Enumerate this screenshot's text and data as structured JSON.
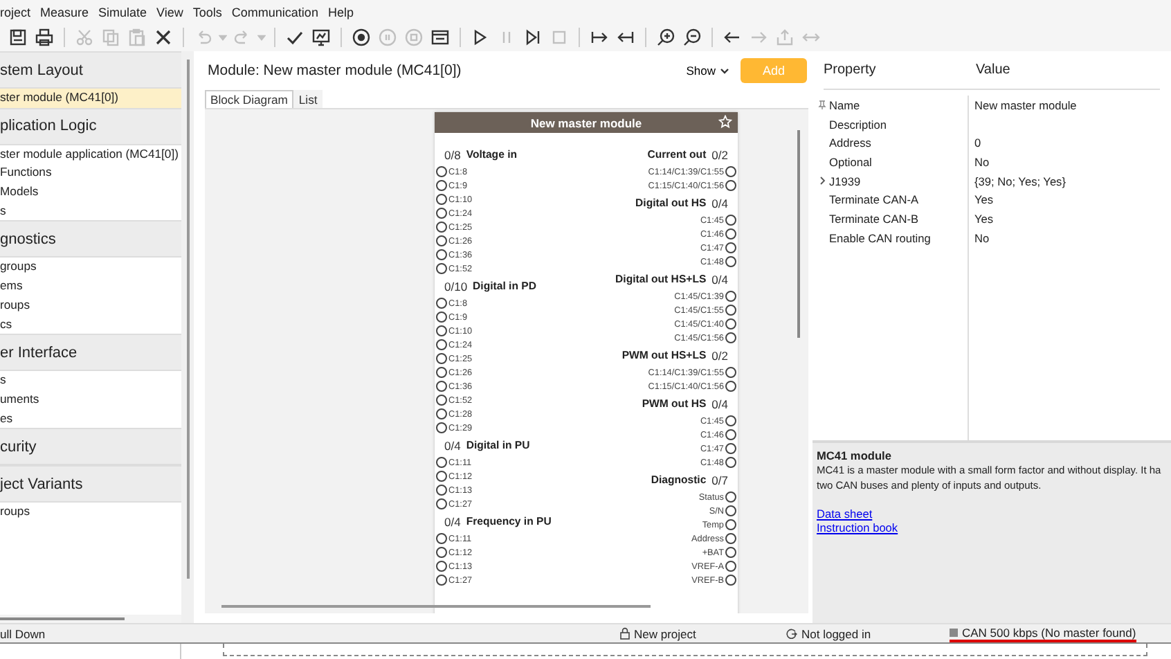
{
  "menu": [
    "roject",
    "Measure",
    "Simulate",
    "View",
    "Tools",
    "Communication",
    "Help"
  ],
  "toolbar": [
    {
      "kind": "save",
      "disabled": false
    },
    {
      "kind": "print",
      "disabled": false
    },
    {
      "kind": "separator"
    },
    {
      "kind": "cut",
      "disabled": true
    },
    {
      "kind": "copy",
      "disabled": true
    },
    {
      "kind": "paste",
      "disabled": true
    },
    {
      "kind": "delete",
      "disabled": false
    },
    {
      "kind": "separator"
    },
    {
      "kind": "undo",
      "disabled": true
    },
    {
      "kind": "dropdown",
      "disabled": true
    },
    {
      "kind": "redo",
      "disabled": true
    },
    {
      "kind": "dropdown",
      "disabled": true
    },
    {
      "kind": "separator"
    },
    {
      "kind": "check",
      "disabled": false
    },
    {
      "kind": "monitor",
      "disabled": false
    },
    {
      "kind": "separator"
    },
    {
      "kind": "record",
      "disabled": false
    },
    {
      "kind": "pause-circle",
      "disabled": true
    },
    {
      "kind": "stop-circle",
      "disabled": true
    },
    {
      "kind": "panel",
      "disabled": false
    },
    {
      "kind": "separator"
    },
    {
      "kind": "play",
      "disabled": false
    },
    {
      "kind": "pause",
      "disabled": true
    },
    {
      "kind": "step",
      "disabled": false
    },
    {
      "kind": "stop",
      "disabled": true
    },
    {
      "kind": "separator"
    },
    {
      "kind": "step-in",
      "disabled": false
    },
    {
      "kind": "step-out",
      "disabled": false
    },
    {
      "kind": "separator"
    },
    {
      "kind": "zoom-in",
      "disabled": false
    },
    {
      "kind": "zoom-out",
      "disabled": false
    },
    {
      "kind": "separator"
    },
    {
      "kind": "back",
      "disabled": false
    },
    {
      "kind": "forward",
      "disabled": true
    },
    {
      "kind": "export",
      "disabled": true
    },
    {
      "kind": "swap",
      "disabled": true
    }
  ],
  "sidebar": {
    "sections": [
      {
        "title": "stem Layout",
        "items": [
          {
            "label": "ster module (MC41[0])",
            "selected": true
          }
        ]
      },
      {
        "title": "plication Logic",
        "items": [
          {
            "label": "ster module application (MC41[0])",
            "selected": false
          },
          {
            "label": "Functions",
            "selected": false
          },
          {
            "label": "Models",
            "selected": false
          },
          {
            "label": "s",
            "selected": false
          }
        ]
      },
      {
        "title": "gnostics",
        "items": [
          {
            "label": "groups",
            "selected": false
          },
          {
            "label": "ems",
            "selected": false
          },
          {
            "label": "roups",
            "selected": false
          },
          {
            "label": "cs",
            "selected": false
          }
        ]
      },
      {
        "title": "er Interface",
        "items": [
          {
            "label": "s",
            "selected": false
          },
          {
            "label": "uments",
            "selected": false
          },
          {
            "label": "es",
            "selected": false
          }
        ]
      },
      {
        "title": "curity"
      },
      {
        "title": "ject Variants",
        "items": [
          {
            "label": "roups",
            "selected": false
          }
        ]
      }
    ]
  },
  "module_panel": {
    "title": "Module: New master module (MC41[0])",
    "show_button": "Show",
    "add_button": "Add",
    "tabs": [
      {
        "label": "Block Diagram",
        "selected": true
      },
      {
        "label": "List",
        "selected": false
      }
    ],
    "module": {
      "title": "New master module",
      "inputs": [
        {
          "count": "0/8",
          "title": "Voltage in",
          "pins": [
            "C1:8",
            "C1:9",
            "C1:10",
            "C1:24",
            "C1:25",
            "C1:26",
            "C1:36",
            "C1:52"
          ]
        },
        {
          "count": "0/10",
          "title": "Digital in PD",
          "pins": [
            "C1:8",
            "C1:9",
            "C1:10",
            "C1:24",
            "C1:25",
            "C1:26",
            "C1:36",
            "C1:52",
            "C1:28",
            "C1:29"
          ]
        },
        {
          "count": "0/4",
          "title": "Digital in PU",
          "pins": [
            "C1:11",
            "C1:12",
            "C1:13",
            "C1:27"
          ]
        },
        {
          "count": "0/4",
          "title": "Frequency in PU",
          "pins": [
            "C1:11",
            "C1:12",
            "C1:13",
            "C1:27"
          ]
        }
      ],
      "outputs": [
        {
          "count": "0/2",
          "title": "Current out",
          "pins": [
            "C1:14/C1:39/C1:55",
            "C1:15/C1:40/C1:56"
          ]
        },
        {
          "count": "0/4",
          "title": "Digital out HS",
          "pins": [
            "C1:45",
            "C1:46",
            "C1:47",
            "C1:48"
          ]
        },
        {
          "count": "0/4",
          "title": "Digital out HS+LS",
          "pins": [
            "C1:45/C1:39",
            "C1:45/C1:55",
            "C1:45/C1:40",
            "C1:45/C1:56"
          ]
        },
        {
          "count": "0/2",
          "title": "PWM out HS+LS",
          "pins": [
            "C1:14/C1:39/C1:55",
            "C1:15/C1:40/C1:56"
          ]
        },
        {
          "count": "0/4",
          "title": "PWM out HS",
          "pins": [
            "C1:45",
            "C1:46",
            "C1:47",
            "C1:48"
          ]
        },
        {
          "count": "0/7",
          "title": "Diagnostic",
          "pins": [
            "Status",
            "S/N",
            "Temp",
            "Address",
            "+BAT",
            "VREF-A",
            "VREF-B"
          ]
        }
      ]
    }
  },
  "properties": {
    "columns": [
      "Property",
      "Value"
    ],
    "rows": [
      {
        "name": "Name",
        "value": "New master module",
        "kind": "pinned"
      },
      {
        "name": "Description",
        "kind": "plain"
      },
      {
        "name": "Address",
        "value": "0",
        "kind": "plain"
      },
      {
        "name": "Optional",
        "value": "No",
        "kind": "plain"
      },
      {
        "name": "J1939",
        "value": "{39; No; Yes; Yes}",
        "kind": "expandable",
        "expanded": false
      },
      {
        "name": "Terminate CAN-A",
        "value": "Yes",
        "kind": "plain"
      },
      {
        "name": "Terminate CAN-B",
        "value": "Yes",
        "kind": "plain"
      },
      {
        "name": "Enable CAN routing",
        "value": "No",
        "kind": "plain"
      }
    ],
    "description": {
      "title": "MC41 module",
      "lines": [
        "MC41 is a master module with a small form factor and without display. It ha",
        "two CAN buses and plenty of inputs and outputs."
      ],
      "links": [
        "Data sheet",
        "Instruction book"
      ]
    }
  },
  "status_bar": {
    "left": "ull Down",
    "project": "New project",
    "login": "Not logged in",
    "connection": "CAN 500 kbps (No master found)"
  }
}
